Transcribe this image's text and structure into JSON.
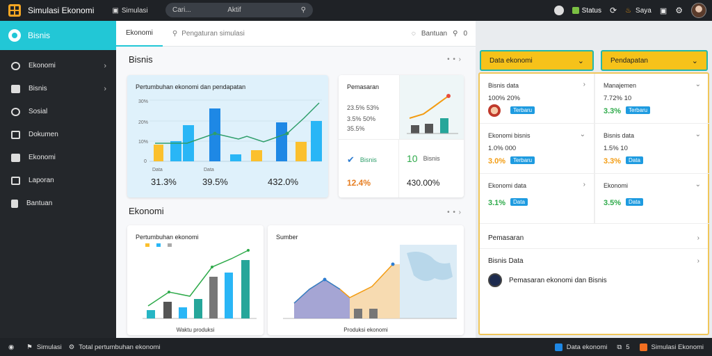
{
  "topbar": {
    "app_title": "Simulasi Ekonomi",
    "nav_link": "Simulasi",
    "search": {
      "placeholder": "Cari...",
      "mode": "Aktif"
    },
    "status_label": "Status",
    "user_label": "Saya"
  },
  "sidebar": {
    "header": "Bisnis",
    "items": [
      {
        "label": "Ekonomi",
        "has_chevron": true
      },
      {
        "label": "Bisnis",
        "has_chevron": true
      },
      {
        "label": "Sosial",
        "has_chevron": false
      },
      {
        "label": "Dokumen",
        "has_chevron": false
      },
      {
        "label": "Ekonomi",
        "has_chevron": false
      },
      {
        "label": "Laporan",
        "has_chevron": false
      },
      {
        "label": "Bantuan",
        "has_chevron": false
      }
    ]
  },
  "main": {
    "tabs": [
      {
        "label": "Ekonomi"
      },
      {
        "label": "Pengaturan simulasi"
      }
    ],
    "right_link": "Bantuan",
    "right_count": "0",
    "section1_title": "Bisnis",
    "section2_title": "Ekonomi",
    "panel1": {
      "title": "Pertumbuhan ekonomi dan pendapatan",
      "ticks": [
        "30%",
        "20%",
        "10%",
        "0"
      ],
      "stats": [
        {
          "label": "Data",
          "value": "31.3%"
        },
        {
          "label": "Data",
          "value": "39.5%"
        },
        {
          "label": "",
          "value": "432.0%"
        }
      ],
      "colors": {
        "blue": "#1e88e5",
        "cyan": "#29b6f6",
        "yellow": "#fbc02d",
        "line": "#2e9e6a"
      }
    },
    "panel2": {
      "title": "Pemasaran",
      "line1": "23.5% 53%",
      "line2": "3.5% 50%",
      "line3": "35.5%",
      "kpi_left_label": "Bisnis",
      "kpi_left_value": "12.4%",
      "kpi_right_value": "10",
      "kpi_right_label": "Bisnis",
      "kpi_right_big": "430.00%"
    },
    "panel3": {
      "title": "Pertumbuhan ekonomi",
      "xlabel": "Waktu produksi"
    },
    "panel4": {
      "title": "Sumber",
      "xlabel": "Produksi ekonomi"
    }
  },
  "right": {
    "dropdown1": "Data ekonomi",
    "dropdown2": "Pendapatan",
    "cells": [
      {
        "title": "Bisnis data",
        "value": "100% 20%",
        "pct": "",
        "tag": "Terbaru",
        "has_avatar": true,
        "pct_color": "#2eaa4a"
      },
      {
        "title": "Manajemen",
        "value": "7.72% 10",
        "pct": "3.3%",
        "tag": "Terbaru",
        "has_avatar": false,
        "pct_color": "#2eaa4a"
      },
      {
        "title": "Ekonomi bisnis",
        "value": "1.0% 000",
        "pct": "3.0%",
        "tag": "Terbaru",
        "has_avatar": false,
        "pct_color": "#f39c12"
      },
      {
        "title": "Bisnis data",
        "value": "1.5% 10",
        "pct": "3.3%",
        "tag": "Data",
        "has_avatar": false,
        "pct_color": "#f39c12"
      },
      {
        "title": "Ekonomi data",
        "value": "",
        "pct": "3.1%",
        "tag": "Data",
        "has_avatar": false,
        "pct_color": "#2eaa4a"
      },
      {
        "title": "Ekonomi",
        "value": "",
        "pct": "3.5%",
        "tag": "Data",
        "has_avatar": false,
        "pct_color": "#2eaa4a"
      }
    ],
    "row1": "Pemasaran",
    "row2": "Bisnis Data",
    "row3": "Pemasaran ekonomi dan Bisnis"
  },
  "bottombar": {
    "left1": "Simulasi",
    "left2": "Total pertumbuhan ekonomi",
    "right1": "Data ekonomi",
    "right2": "5",
    "right3": "Simulasi Ekonomi"
  }
}
